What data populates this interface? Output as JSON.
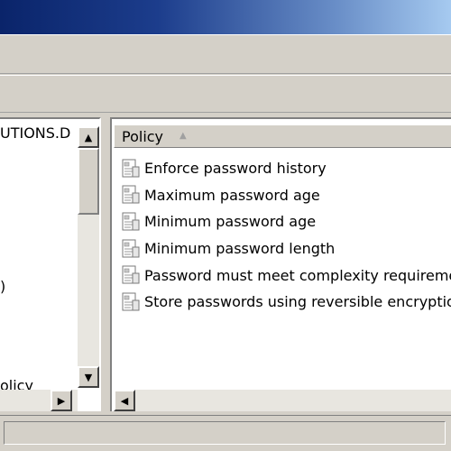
{
  "tree": {
    "root_label": "UTIONS.D",
    "item_partial_1": ")",
    "item_partial_2": "olicy"
  },
  "list": {
    "column_header": "Policy",
    "policies": [
      "Enforce password history",
      "Maximum password age",
      "Minimum password age",
      "Minimum password length",
      "Password must meet complexity requirements",
      "Store passwords using reversible encryption"
    ]
  },
  "icons": {
    "scroll_up": "triangle-up-icon",
    "scroll_down": "triangle-down-icon",
    "scroll_left": "triangle-left-icon",
    "scroll_right": "triangle-right-icon",
    "sort": "sort-ascending-icon",
    "policy": "policy-setting-icon"
  },
  "colors": {
    "titlebar_start": "#0a246a",
    "titlebar_end": "#a6caf0",
    "chrome": "#d4d0c8"
  }
}
